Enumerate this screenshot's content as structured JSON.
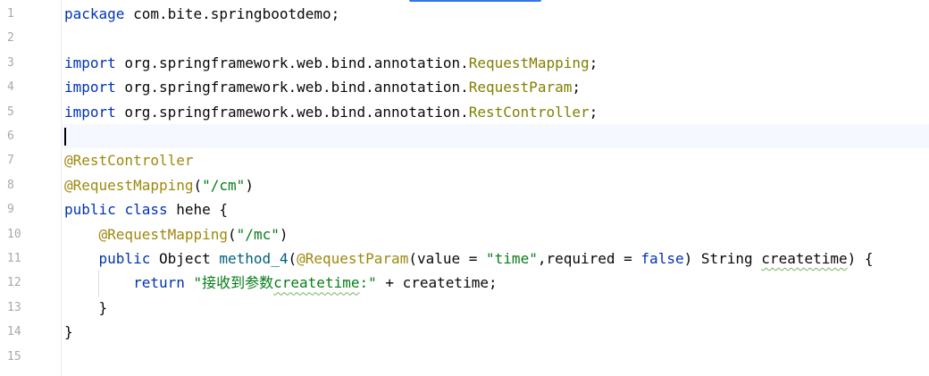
{
  "editor": {
    "language": "java",
    "current_line": 6,
    "colors": {
      "keyword": "#0033b3",
      "annotation": "#9e880d",
      "string": "#067d17",
      "imported_class": "#808000",
      "method_name": "#00627a",
      "text": "#080808",
      "line_number": "#a7a9b0",
      "current_line_bg": "#f5f8fe",
      "top_tab_accent": "#3574f0"
    }
  },
  "line_numbers": [
    "1",
    "2",
    "3",
    "4",
    "5",
    "6",
    "7",
    "8",
    "9",
    "10",
    "11",
    "12",
    "13",
    "14",
    "15"
  ],
  "code": {
    "l1": {
      "kw": "package",
      "rest": " com.bite.springbootdemo;"
    },
    "l3": {
      "kw": "import",
      "pkg": " org.springframework.web.bind.annotation.",
      "cls": "RequestMapping",
      "end": ";"
    },
    "l4": {
      "kw": "import",
      "pkg": " org.springframework.web.bind.annotation.",
      "cls": "RequestParam",
      "end": ";"
    },
    "l5": {
      "kw": "import",
      "pkg": " org.springframework.web.bind.annotation.",
      "cls": "RestController",
      "end": ";"
    },
    "l7": {
      "ann": "@RestController"
    },
    "l8": {
      "ann": "@RequestMapping",
      "open": "(",
      "str": "\"/cm\"",
      "close": ")"
    },
    "l9": {
      "kw1": "public",
      "kw2": "class",
      "name": " hehe {"
    },
    "l10": {
      "indent": "    ",
      "ann": "@RequestMapping",
      "open": "(",
      "str": "\"/mc\"",
      "close": ")"
    },
    "l11": {
      "indent": "    ",
      "kw": "public",
      "type": " Object ",
      "method": "method_4",
      "open": "(",
      "ann": "@RequestParam",
      "args_a": "(value = ",
      "str": "\"time\"",
      "args_b": ",required = ",
      "bool": "false",
      "args_c": ") String ",
      "param": "createtime",
      "end": ") {"
    },
    "l12": {
      "indent": "        ",
      "kw": "return",
      "space": " ",
      "str_a": "\"接收到参数",
      "str_b": "createtime",
      "str_c": ":\"",
      "rest": " + createtime;"
    },
    "l13": {
      "text": "    }"
    },
    "l14": {
      "text": "}"
    }
  }
}
